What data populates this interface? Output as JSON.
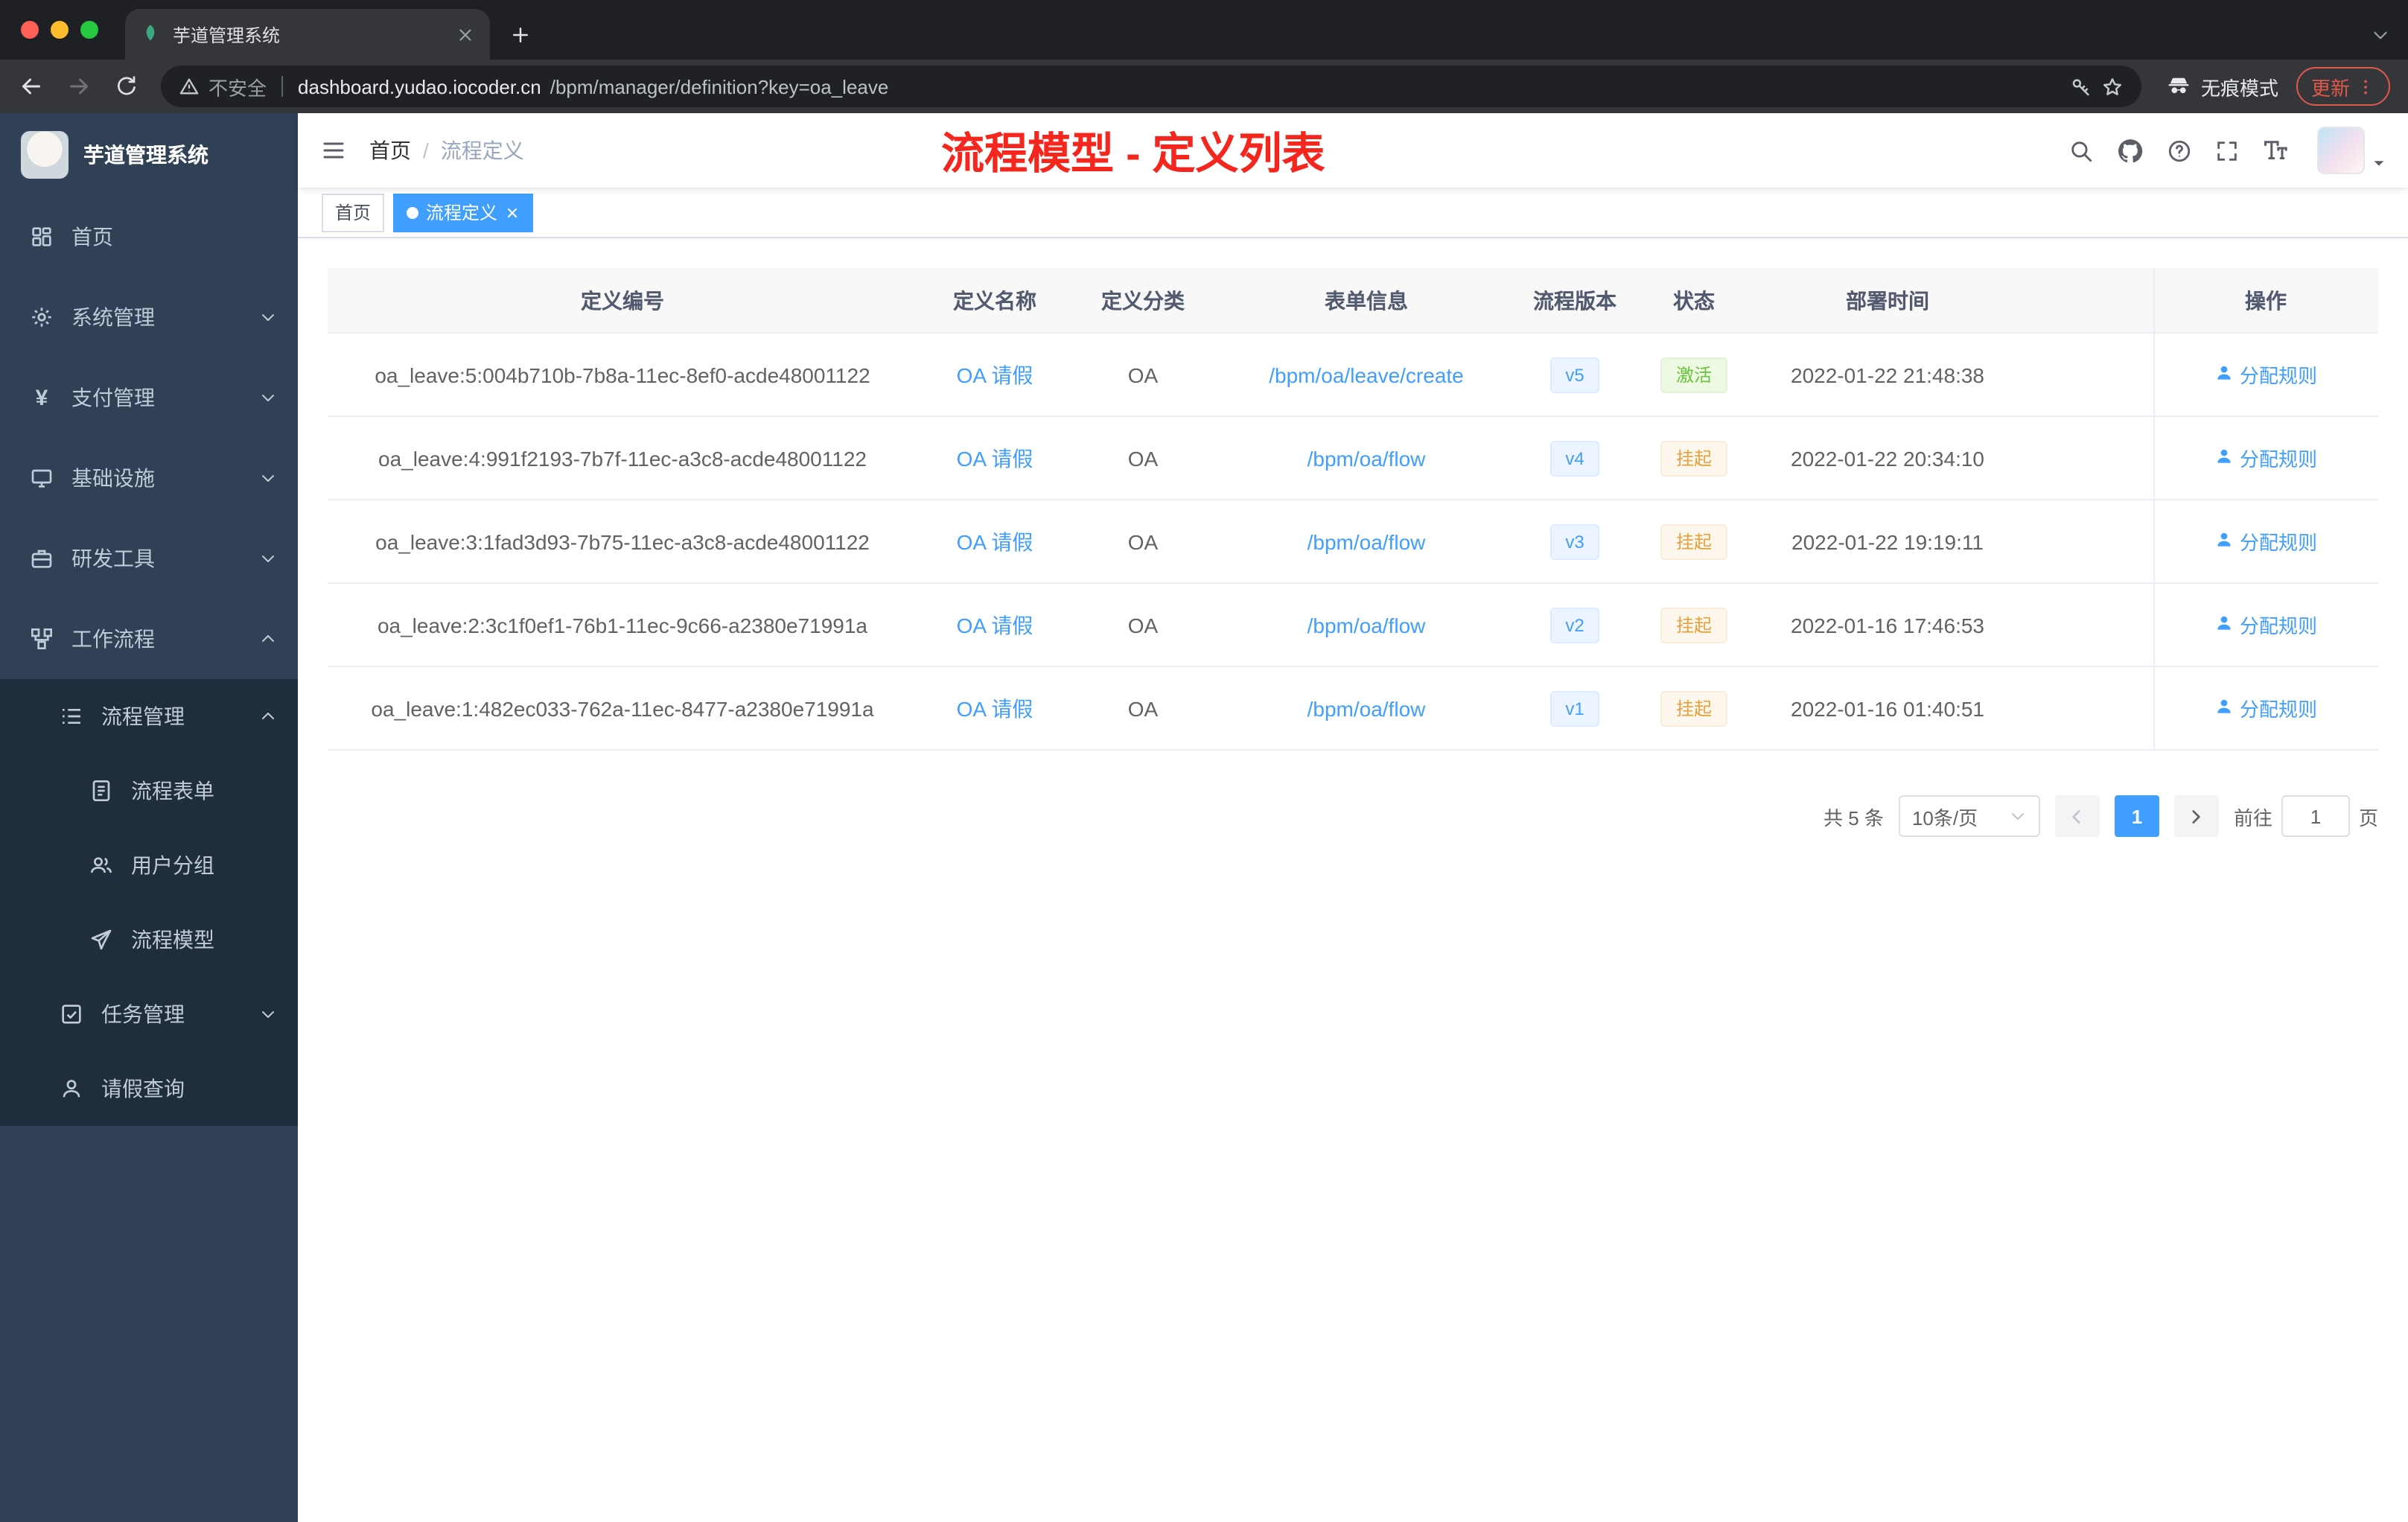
{
  "browser": {
    "tab_title": "芋道管理系统",
    "security_label": "不安全",
    "url_domain": "dashboard.yudao.iocoder.cn",
    "url_path": "/bpm/manager/definition?key=oa_leave",
    "incognito_label": "无痕模式",
    "update_label": "更新"
  },
  "sidebar": {
    "logo_title": "芋道管理系统",
    "items": [
      {
        "label": "首页"
      },
      {
        "label": "系统管理"
      },
      {
        "label": "支付管理"
      },
      {
        "label": "基础设施"
      },
      {
        "label": "研发工具"
      },
      {
        "label": "工作流程"
      },
      {
        "label": "流程管理"
      },
      {
        "label": "流程表单"
      },
      {
        "label": "用户分组"
      },
      {
        "label": "流程模型"
      },
      {
        "label": "任务管理"
      },
      {
        "label": "请假查询"
      }
    ]
  },
  "header": {
    "breadcrumb_home": "首页",
    "breadcrumb_separator": "/",
    "breadcrumb_current": "流程定义",
    "annotation": "流程模型 - 定义列表"
  },
  "tags": {
    "home_label": "首页",
    "active_label": "流程定义"
  },
  "table": {
    "columns": [
      "定义编号",
      "定义名称",
      "定义分类",
      "表单信息",
      "流程版本",
      "状态",
      "部署时间",
      "操作"
    ],
    "rows": [
      {
        "id": "oa_leave:5:004b710b-7b8a-11ec-8ef0-acde48001122",
        "name": "OA 请假",
        "category": "OA",
        "form": "/bpm/oa/leave/create",
        "version": "v5",
        "status": "激活",
        "status_type": "success",
        "time": "2022-01-22 21:48:38",
        "action": "分配规则"
      },
      {
        "id": "oa_leave:4:991f2193-7b7f-11ec-a3c8-acde48001122",
        "name": "OA 请假",
        "category": "OA",
        "form": "/bpm/oa/flow",
        "version": "v4",
        "status": "挂起",
        "status_type": "warning",
        "time": "2022-01-22 20:34:10",
        "action": "分配规则"
      },
      {
        "id": "oa_leave:3:1fad3d93-7b75-11ec-a3c8-acde48001122",
        "name": "OA 请假",
        "category": "OA",
        "form": "/bpm/oa/flow",
        "version": "v3",
        "status": "挂起",
        "status_type": "warning",
        "time": "2022-01-22 19:19:11",
        "action": "分配规则"
      },
      {
        "id": "oa_leave:2:3c1f0ef1-76b1-11ec-9c66-a2380e71991a",
        "name": "OA 请假",
        "category": "OA",
        "form": "/bpm/oa/flow",
        "version": "v2",
        "status": "挂起",
        "status_type": "warning",
        "time": "2022-01-16 17:46:53",
        "action": "分配规则"
      },
      {
        "id": "oa_leave:1:482ec033-762a-11ec-8477-a2380e71991a",
        "name": "OA 请假",
        "category": "OA",
        "form": "/bpm/oa/flow",
        "version": "v1",
        "status": "挂起",
        "status_type": "warning",
        "time": "2022-01-16 01:40:51",
        "action": "分配规则"
      }
    ]
  },
  "pagination": {
    "total": "共 5 条",
    "page_size": "10条/页",
    "current_page": "1",
    "goto_label": "前往",
    "goto_value": "1",
    "page_unit": "页"
  },
  "colors": {
    "accent": "#409eff",
    "annotation": "#f5261d",
    "success": "#67c23a",
    "warning": "#e6a23c",
    "sidebar_bg": "#304156",
    "sidebar_submenu_bg": "#1f2d3d"
  }
}
